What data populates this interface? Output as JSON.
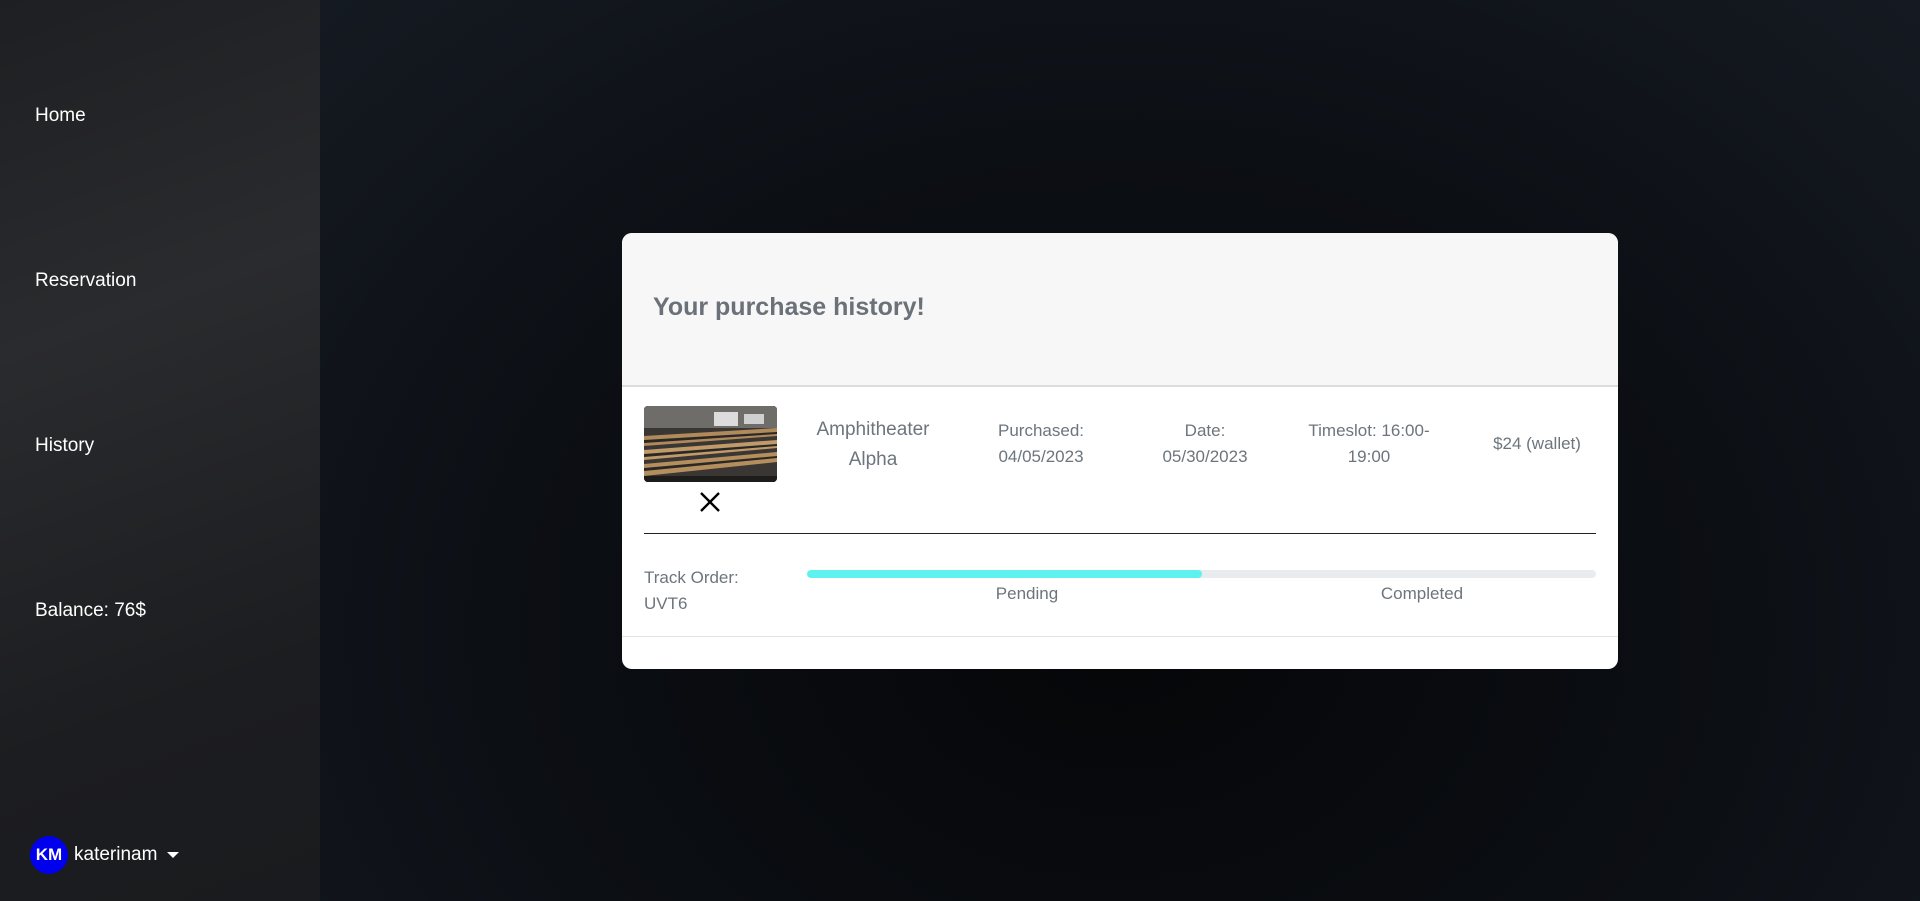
{
  "sidebar": {
    "items": [
      {
        "label": "Home"
      },
      {
        "label": "Reservation"
      },
      {
        "label": "History"
      },
      {
        "label": "Balance: 76$"
      }
    ],
    "user": {
      "initials": "KM",
      "username": "katerinam",
      "avatar_color": "#0000ee"
    }
  },
  "modal": {
    "title": "Your purchase history!",
    "order": {
      "venue": "Amphitheater Alpha",
      "purchased_label": "Purchased:",
      "purchased_date": "04/05/2023",
      "date_label": "Date:",
      "date": "05/30/2023",
      "timeslot_line1": "Timeslot: 16:00-",
      "timeslot_line2": "19:00",
      "price": "$24 (wallet)",
      "track_label": "Track Order:",
      "track_code": "UVT6",
      "progress_fraction": 0.5,
      "progress_color": "#5ef2ee",
      "steps": [
        "Pending",
        "Completed"
      ],
      "image_icon": "lecture-hall-photo",
      "remove_icon": "close-icon"
    }
  }
}
